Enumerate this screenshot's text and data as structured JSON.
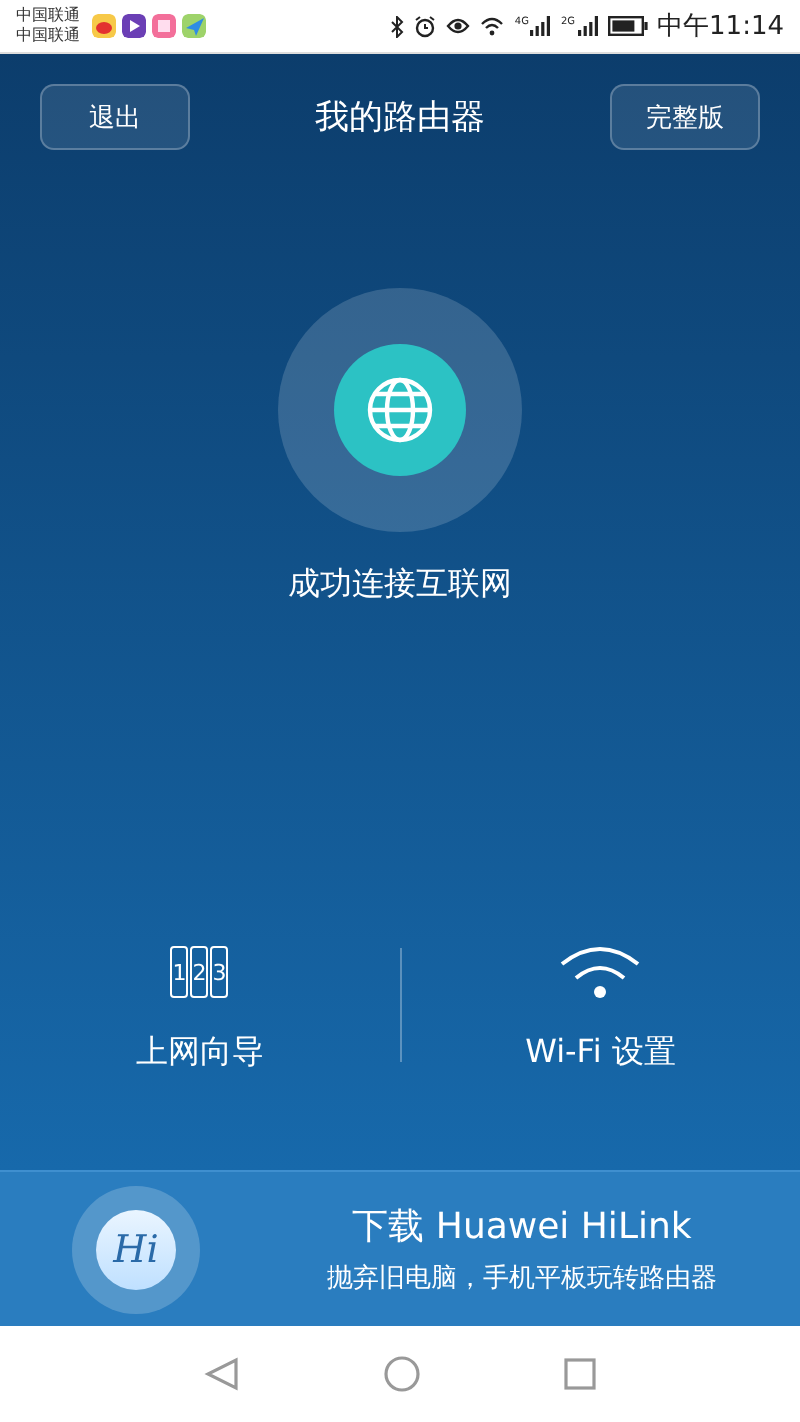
{
  "status_bar": {
    "carriers": [
      "中国联通",
      "中国联通"
    ],
    "network_labels": [
      "4G",
      "2G"
    ],
    "time": "中午11:14"
  },
  "header": {
    "title": "我的路由器",
    "left_button": "退出",
    "right_button": "完整版"
  },
  "connection": {
    "status": "成功连接互联网",
    "connected": true
  },
  "actions": [
    {
      "kind": "steps",
      "label": "上网向导",
      "digits": [
        "1",
        "2",
        "3"
      ]
    },
    {
      "kind": "wifi",
      "label": "Wi-Fi 设置"
    }
  ],
  "banner": {
    "logo_text": "Hi",
    "title": "下载 Huawei HiLink",
    "subtitle": "抛弃旧电脑，手机平板玩转路由器"
  }
}
